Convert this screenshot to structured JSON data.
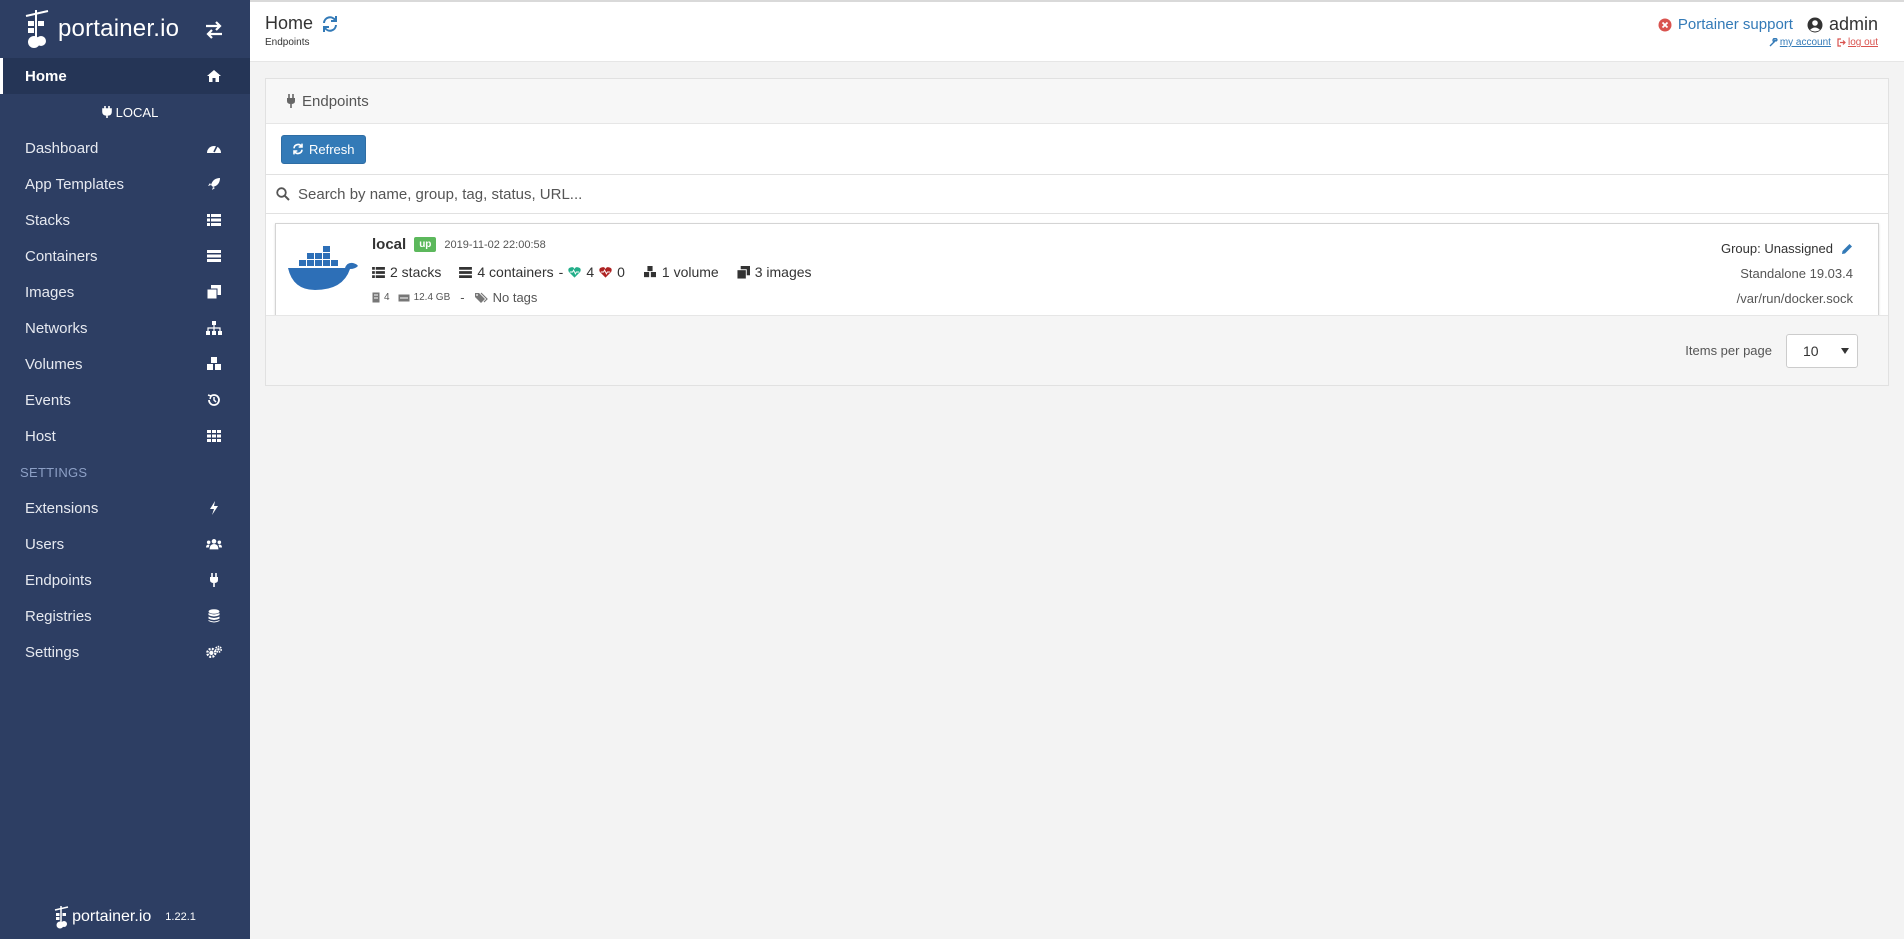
{
  "sidebar": {
    "brand": "portainer.io",
    "home_label": "Home",
    "endpoint_label": "LOCAL",
    "items": [
      {
        "label": "Dashboard",
        "icon": "tachometer-icon"
      },
      {
        "label": "App Templates",
        "icon": "rocket-icon"
      },
      {
        "label": "Stacks",
        "icon": "list-icon"
      },
      {
        "label": "Containers",
        "icon": "server-icon"
      },
      {
        "label": "Images",
        "icon": "clone-icon"
      },
      {
        "label": "Networks",
        "icon": "sitemap-icon"
      },
      {
        "label": "Volumes",
        "icon": "cubes-icon"
      },
      {
        "label": "Events",
        "icon": "history-icon"
      },
      {
        "label": "Host",
        "icon": "th-icon"
      }
    ],
    "settings_title": "SETTINGS",
    "settings_items": [
      {
        "label": "Extensions",
        "icon": "bolt-icon"
      },
      {
        "label": "Users",
        "icon": "users-icon"
      },
      {
        "label": "Endpoints",
        "icon": "plug-icon"
      },
      {
        "label": "Registries",
        "icon": "database-icon"
      },
      {
        "label": "Settings",
        "icon": "cogs-icon"
      }
    ],
    "footer_brand": "portainer.io",
    "version": "1.22.1"
  },
  "header": {
    "title": "Home",
    "breadcrumb": "Endpoints",
    "support_label": "Portainer support",
    "username": "admin",
    "my_account": "my account",
    "log_out": "log out"
  },
  "widget": {
    "title": "Endpoints",
    "refresh_label": "Refresh",
    "search_placeholder": "Search by name, group, tag, status, URL...",
    "items_per_page_label": "Items per page",
    "items_per_page_value": "10"
  },
  "endpoint": {
    "name": "local",
    "status": "up",
    "timestamp": "2019-11-02 22:00:58",
    "stacks": "2 stacks",
    "containers": "4 containers",
    "healthy": "4",
    "unhealthy": "0",
    "volumes": "1 volume",
    "images": "3 images",
    "cpu": "4",
    "memory": "12.4 GB",
    "tags": "No tags",
    "group": "Group: Unassigned",
    "type": "Standalone 19.03.4",
    "url": "/var/run/docker.sock"
  },
  "colors": {
    "sidebar_bg": "#2d3e63",
    "primary": "#337ab7",
    "status_up": "#5cb85c",
    "danger": "#d9534f"
  }
}
